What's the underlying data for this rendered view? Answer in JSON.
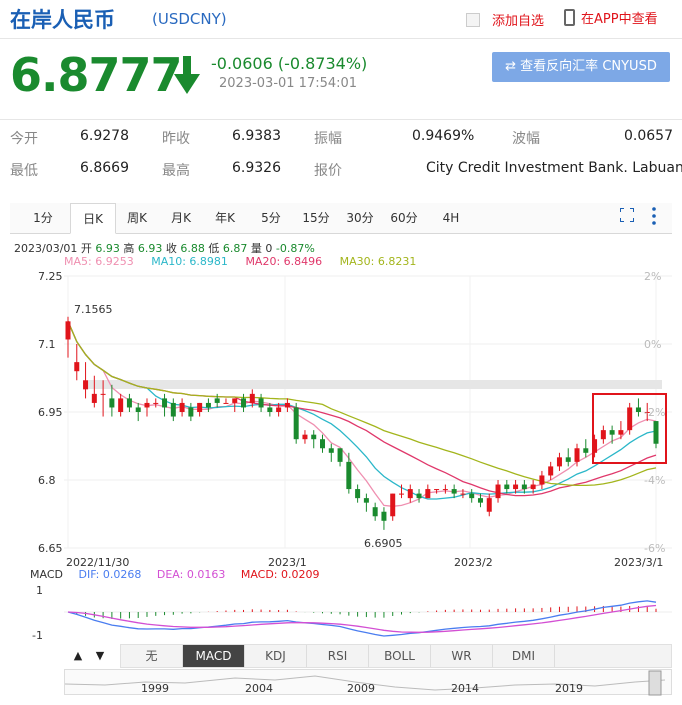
{
  "header": {
    "title": "在岸人民币",
    "code": "(USDCNY)",
    "add_favorite": "添加自选",
    "app_view": "在APP中查看"
  },
  "quote": {
    "price": "6.8777",
    "change": "-0.0606 (-0.8734%)",
    "time": "2023-03-01 17:54:01",
    "reverse_button": "⇄ 查看反向汇率 CNYUSD"
  },
  "stats": {
    "row1": [
      {
        "label": "今开",
        "value": "6.9278"
      },
      {
        "label": "昨收",
        "value": "6.9383"
      },
      {
        "label": "振幅",
        "value": "0.9469%"
      },
      {
        "label": "波幅",
        "value": "0.0657"
      }
    ],
    "row2": [
      {
        "label": "最低",
        "value": "6.8669"
      },
      {
        "label": "最高",
        "value": "6.9326"
      },
      {
        "label": "报价",
        "value": "City Credit Investment Bank. Labuan"
      }
    ]
  },
  "tabs": [
    "1分",
    "日K",
    "周K",
    "月K",
    "年K",
    "5分",
    "15分",
    "30分",
    "60分",
    "4H"
  ],
  "active_tab": "日K",
  "info_line": {
    "date": "2023/03/01",
    "open_label": "开",
    "open": "6.93",
    "high_label": "高",
    "high": "6.93",
    "close_label": "收",
    "close": "6.88",
    "low_label": "低",
    "low": "6.87",
    "vol_label": "量",
    "vol": "0",
    "pct": "-0.87%"
  },
  "ma_labels": [
    {
      "text": "MA5: 6.9253",
      "color": "#ef8fb0"
    },
    {
      "text": "MA10: 6.8981",
      "color": "#2bb7c9"
    },
    {
      "text": "MA20: 6.8496",
      "color": "#e0386b"
    },
    {
      "text": "MA30: 6.8231",
      "color": "#a3b51c"
    }
  ],
  "macd_labels": {
    "name": "MACD",
    "dif": "DIF: 0.0268",
    "dea": "DEA: 0.0163",
    "macd": "MACD: 0.0209"
  },
  "indicators": [
    "无",
    "MACD",
    "KDJ",
    "RSI",
    "BOLL",
    "WR",
    "DMI"
  ],
  "active_indicator": "MACD",
  "timeline_years": [
    "1999",
    "2004",
    "2009",
    "2014",
    "2019"
  ],
  "colors": {
    "up": "#e0141b",
    "down": "#1a8a2e",
    "accent": "#1a5fb4"
  },
  "chart_data": {
    "type": "candlestick",
    "ylim": [
      6.65,
      7.25
    ],
    "y_ticks": [
      "7.25",
      "7.1",
      "6.95",
      "6.8",
      "6.65"
    ],
    "y_ticks_right": [
      "2%",
      "0%",
      "-2%",
      "-4%",
      "-6%"
    ],
    "x_labels": [
      "2022/11/30",
      "2023/1",
      "2023/2",
      "2023/3/1"
    ],
    "annotations": [
      "7.1565",
      "6.6905"
    ],
    "candles": [
      [
        7.11,
        7.15,
        7.16,
        7.07
      ],
      [
        7.04,
        7.06,
        7.1,
        7.02
      ],
      [
        7.0,
        7.02,
        7.06,
        6.98
      ],
      [
        6.97,
        6.99,
        7.03,
        6.96
      ],
      [
        6.99,
        6.99,
        7.02,
        6.94
      ],
      [
        6.98,
        6.96,
        7.01,
        6.94
      ],
      [
        6.95,
        6.98,
        6.99,
        6.94
      ],
      [
        6.98,
        6.96,
        6.99,
        6.95
      ],
      [
        6.96,
        6.95,
        6.97,
        6.93
      ],
      [
        6.96,
        6.97,
        6.98,
        6.94
      ],
      [
        6.97,
        6.97,
        6.98,
        6.96
      ],
      [
        6.98,
        6.96,
        6.99,
        6.94
      ],
      [
        6.97,
        6.94,
        6.98,
        6.93
      ],
      [
        6.95,
        6.97,
        6.98,
        6.94
      ],
      [
        6.96,
        6.94,
        6.97,
        6.93
      ],
      [
        6.95,
        6.97,
        6.97,
        6.94
      ],
      [
        6.97,
        6.96,
        6.98,
        6.95
      ],
      [
        6.98,
        6.97,
        6.99,
        6.96
      ],
      [
        6.97,
        6.97,
        6.98,
        6.97
      ],
      [
        6.97,
        6.98,
        6.98,
        6.95
      ],
      [
        6.98,
        6.96,
        6.99,
        6.95
      ],
      [
        6.97,
        6.99,
        7.0,
        6.96
      ],
      [
        6.98,
        6.96,
        6.99,
        6.95
      ],
      [
        6.96,
        6.95,
        6.97,
        6.94
      ],
      [
        6.95,
        6.96,
        6.97,
        6.94
      ],
      [
        6.96,
        6.97,
        6.98,
        6.95
      ],
      [
        6.96,
        6.89,
        6.97,
        6.88
      ],
      [
        6.89,
        6.9,
        6.91,
        6.88
      ],
      [
        6.9,
        6.89,
        6.91,
        6.87
      ],
      [
        6.89,
        6.87,
        6.9,
        6.86
      ],
      [
        6.87,
        6.86,
        6.88,
        6.84
      ],
      [
        6.87,
        6.84,
        6.87,
        6.83
      ],
      [
        6.84,
        6.78,
        6.86,
        6.77
      ],
      [
        6.78,
        6.76,
        6.79,
        6.75
      ],
      [
        6.76,
        6.75,
        6.77,
        6.73
      ],
      [
        6.74,
        6.72,
        6.75,
        6.71
      ],
      [
        6.73,
        6.71,
        6.74,
        6.69
      ],
      [
        6.72,
        6.77,
        6.77,
        6.71
      ],
      [
        6.77,
        6.77,
        6.79,
        6.76
      ],
      [
        6.76,
        6.78,
        6.79,
        6.75
      ],
      [
        6.77,
        6.76,
        6.78,
        6.75
      ],
      [
        6.76,
        6.78,
        6.79,
        6.76
      ],
      [
        6.78,
        6.78,
        6.78,
        6.77
      ],
      [
        6.78,
        6.78,
        6.79,
        6.77
      ],
      [
        6.78,
        6.77,
        6.79,
        6.76
      ],
      [
        6.77,
        6.77,
        6.78,
        6.76
      ],
      [
        6.77,
        6.76,
        6.78,
        6.75
      ],
      [
        6.76,
        6.75,
        6.77,
        6.74
      ],
      [
        6.73,
        6.76,
        6.77,
        6.72
      ],
      [
        6.76,
        6.79,
        6.8,
        6.75
      ],
      [
        6.79,
        6.78,
        6.8,
        6.77
      ],
      [
        6.78,
        6.79,
        6.8,
        6.77
      ],
      [
        6.79,
        6.78,
        6.8,
        6.77
      ],
      [
        6.78,
        6.79,
        6.8,
        6.77
      ],
      [
        6.79,
        6.81,
        6.82,
        6.78
      ],
      [
        6.81,
        6.83,
        6.84,
        6.8
      ],
      [
        6.83,
        6.85,
        6.86,
        6.82
      ],
      [
        6.85,
        6.84,
        6.87,
        6.83
      ],
      [
        6.84,
        6.87,
        6.88,
        6.83
      ],
      [
        6.87,
        6.86,
        6.89,
        6.85
      ],
      [
        6.86,
        6.89,
        6.9,
        6.85
      ],
      [
        6.89,
        6.91,
        6.92,
        6.88
      ],
      [
        6.91,
        6.9,
        6.92,
        6.88
      ],
      [
        6.9,
        6.91,
        6.93,
        6.89
      ],
      [
        6.91,
        6.96,
        6.97,
        6.9
      ],
      [
        6.96,
        6.95,
        6.98,
        6.94
      ],
      [
        6.95,
        6.95,
        6.97,
        6.93
      ],
      [
        6.93,
        6.88,
        6.93,
        6.87
      ]
    ]
  }
}
